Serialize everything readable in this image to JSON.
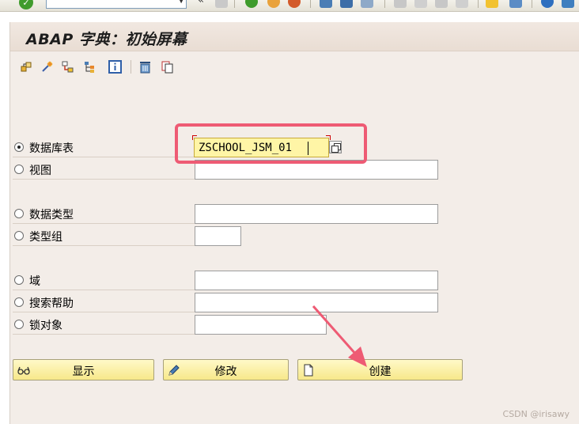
{
  "window": {
    "title": "ABAP 字典：初始屏幕"
  },
  "system_toolbar": {
    "command_field_value": "",
    "nav_glyph": "«",
    "icons": [
      "enter-icon",
      "save-icon",
      "back-icon",
      "exit-icon",
      "cancel-icon",
      "print-icon",
      "find-icon",
      "find-next-icon",
      "first-page-icon",
      "prev-page-icon",
      "next-page-icon",
      "last-page-icon",
      "new-session-icon",
      "shortcut-icon",
      "help-icon",
      "layout-icon"
    ]
  },
  "app_toolbar": {
    "icons": [
      "other-object-icon",
      "check-icon",
      "where-used-icon",
      "hierarchy-icon",
      "info-icon",
      "delete-icon",
      "copy-icon"
    ]
  },
  "form": {
    "rows": [
      {
        "label": "数据库表",
        "selected": true,
        "value": "ZSCHOOL_JSM_01"
      },
      {
        "label": "视图",
        "selected": false,
        "value": ""
      },
      {
        "label": "数据类型",
        "selected": false,
        "value": ""
      },
      {
        "label": "类型组",
        "selected": false,
        "value": ""
      },
      {
        "label": "域",
        "selected": false,
        "value": ""
      },
      {
        "label": "搜索帮助",
        "selected": false,
        "value": ""
      },
      {
        "label": "锁对象",
        "selected": false,
        "value": ""
      }
    ]
  },
  "buttons": {
    "display": "显示",
    "change": "修改",
    "create": "创建"
  },
  "watermark": "CSDN @irisawy",
  "colors": {
    "panel_bg": "#f3ede8",
    "active_field_bg": "#fff5a6",
    "button_bg": "#f7e88a",
    "annotation": "#ee5b74"
  }
}
